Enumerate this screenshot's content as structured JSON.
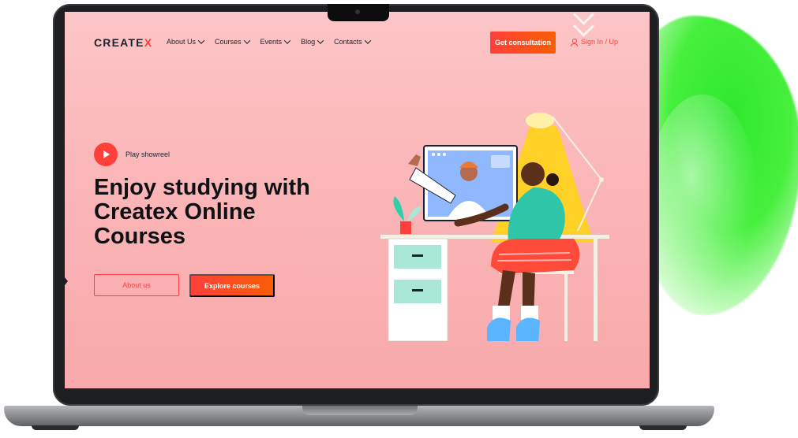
{
  "logo": {
    "main": "CREATE",
    "accent": "X"
  },
  "nav": {
    "items": [
      {
        "label": "About Us"
      },
      {
        "label": "Courses"
      },
      {
        "label": "Events"
      },
      {
        "label": "Blog"
      },
      {
        "label": "Contacts"
      }
    ]
  },
  "header": {
    "consult_label": "Get consultation",
    "signin_label": "Sign In / Up"
  },
  "hero": {
    "showreel_label": "Play showreel",
    "headline": "Enjoy studying with Createx Online Courses",
    "about_label": "About us",
    "explore_label": "Explore courses"
  },
  "colors": {
    "accent": "#ff3f3a",
    "accent2": "#f75e05",
    "screen_bg": "#fbb6b8",
    "blob": "#46ef3c",
    "text": "#1e212c"
  }
}
